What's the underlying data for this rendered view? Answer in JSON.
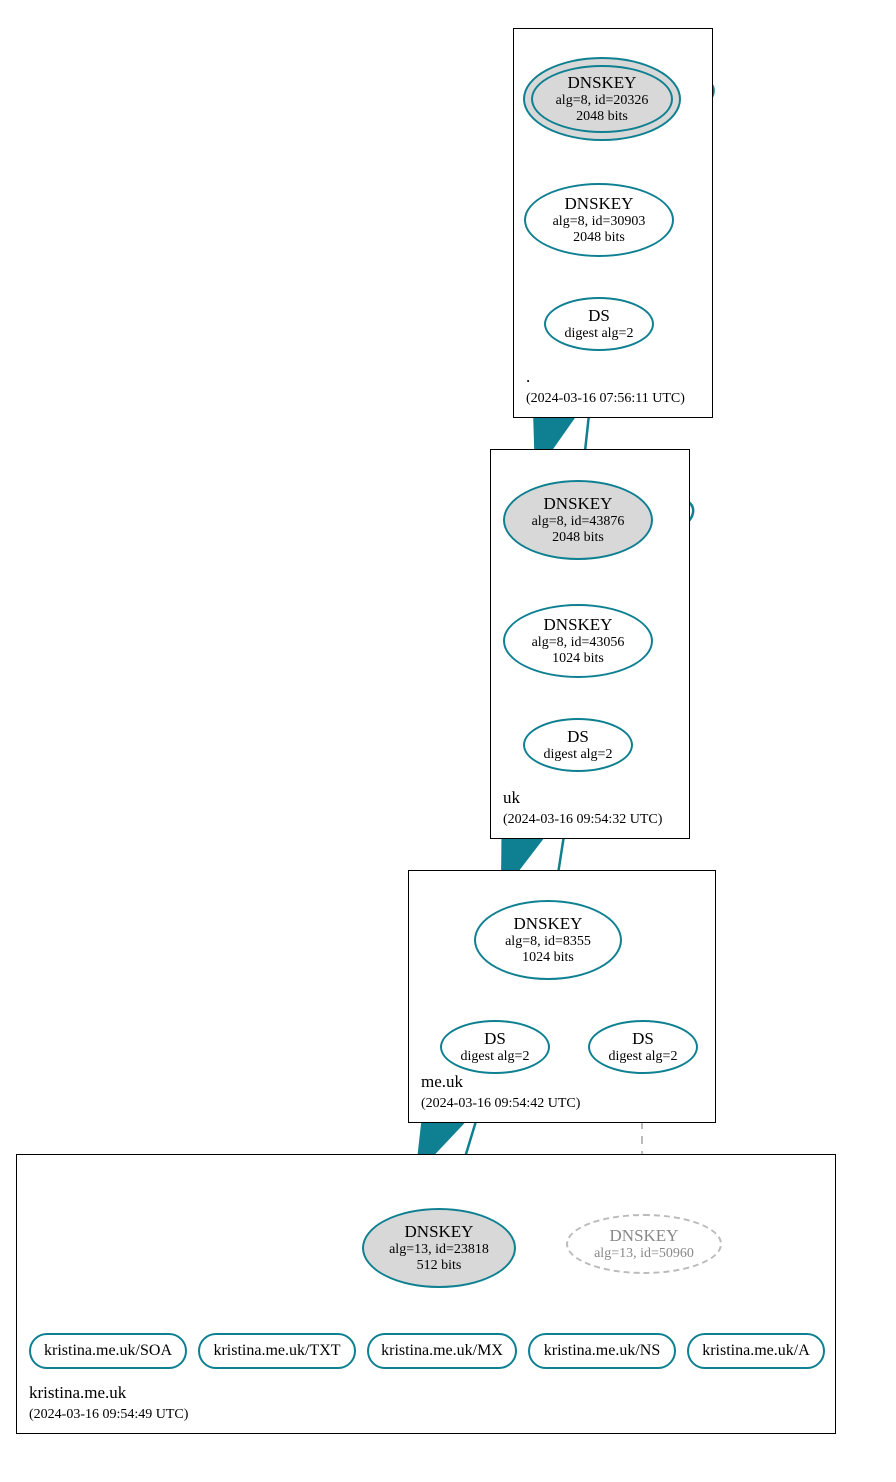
{
  "zones": {
    "root": {
      "label": ".",
      "time": "(2024-03-16 07:56:11 UTC)",
      "ksk": {
        "title": "DNSKEY",
        "l1": "alg=8, id=20326",
        "l2": "2048 bits"
      },
      "zsk": {
        "title": "DNSKEY",
        "l1": "alg=8, id=30903",
        "l2": "2048 bits"
      },
      "ds": {
        "title": "DS",
        "l1": "digest alg=2"
      }
    },
    "uk": {
      "label": "uk",
      "time": "(2024-03-16 09:54:32 UTC)",
      "ksk": {
        "title": "DNSKEY",
        "l1": "alg=8, id=43876",
        "l2": "2048 bits"
      },
      "zsk": {
        "title": "DNSKEY",
        "l1": "alg=8, id=43056",
        "l2": "1024 bits"
      },
      "ds": {
        "title": "DS",
        "l1": "digest alg=2"
      }
    },
    "meuk": {
      "label": "me.uk",
      "time": "(2024-03-16 09:54:42 UTC)",
      "key": {
        "title": "DNSKEY",
        "l1": "alg=8, id=8355",
        "l2": "1024 bits"
      },
      "ds1": {
        "title": "DS",
        "l1": "digest alg=2"
      },
      "ds2": {
        "title": "DS",
        "l1": "digest alg=2"
      }
    },
    "kristina": {
      "label": "kristina.me.uk",
      "time": "(2024-03-16 09:54:49 UTC)",
      "key": {
        "title": "DNSKEY",
        "l1": "alg=13, id=23818",
        "l2": "512 bits"
      },
      "key2": {
        "title": "DNSKEY",
        "l1": "alg=13, id=50960"
      },
      "rr": {
        "soa": "kristina.me.uk/SOA",
        "txt": "kristina.me.uk/TXT",
        "mx": "kristina.me.uk/MX",
        "ns": "kristina.me.uk/NS",
        "a": "kristina.me.uk/A"
      }
    }
  }
}
